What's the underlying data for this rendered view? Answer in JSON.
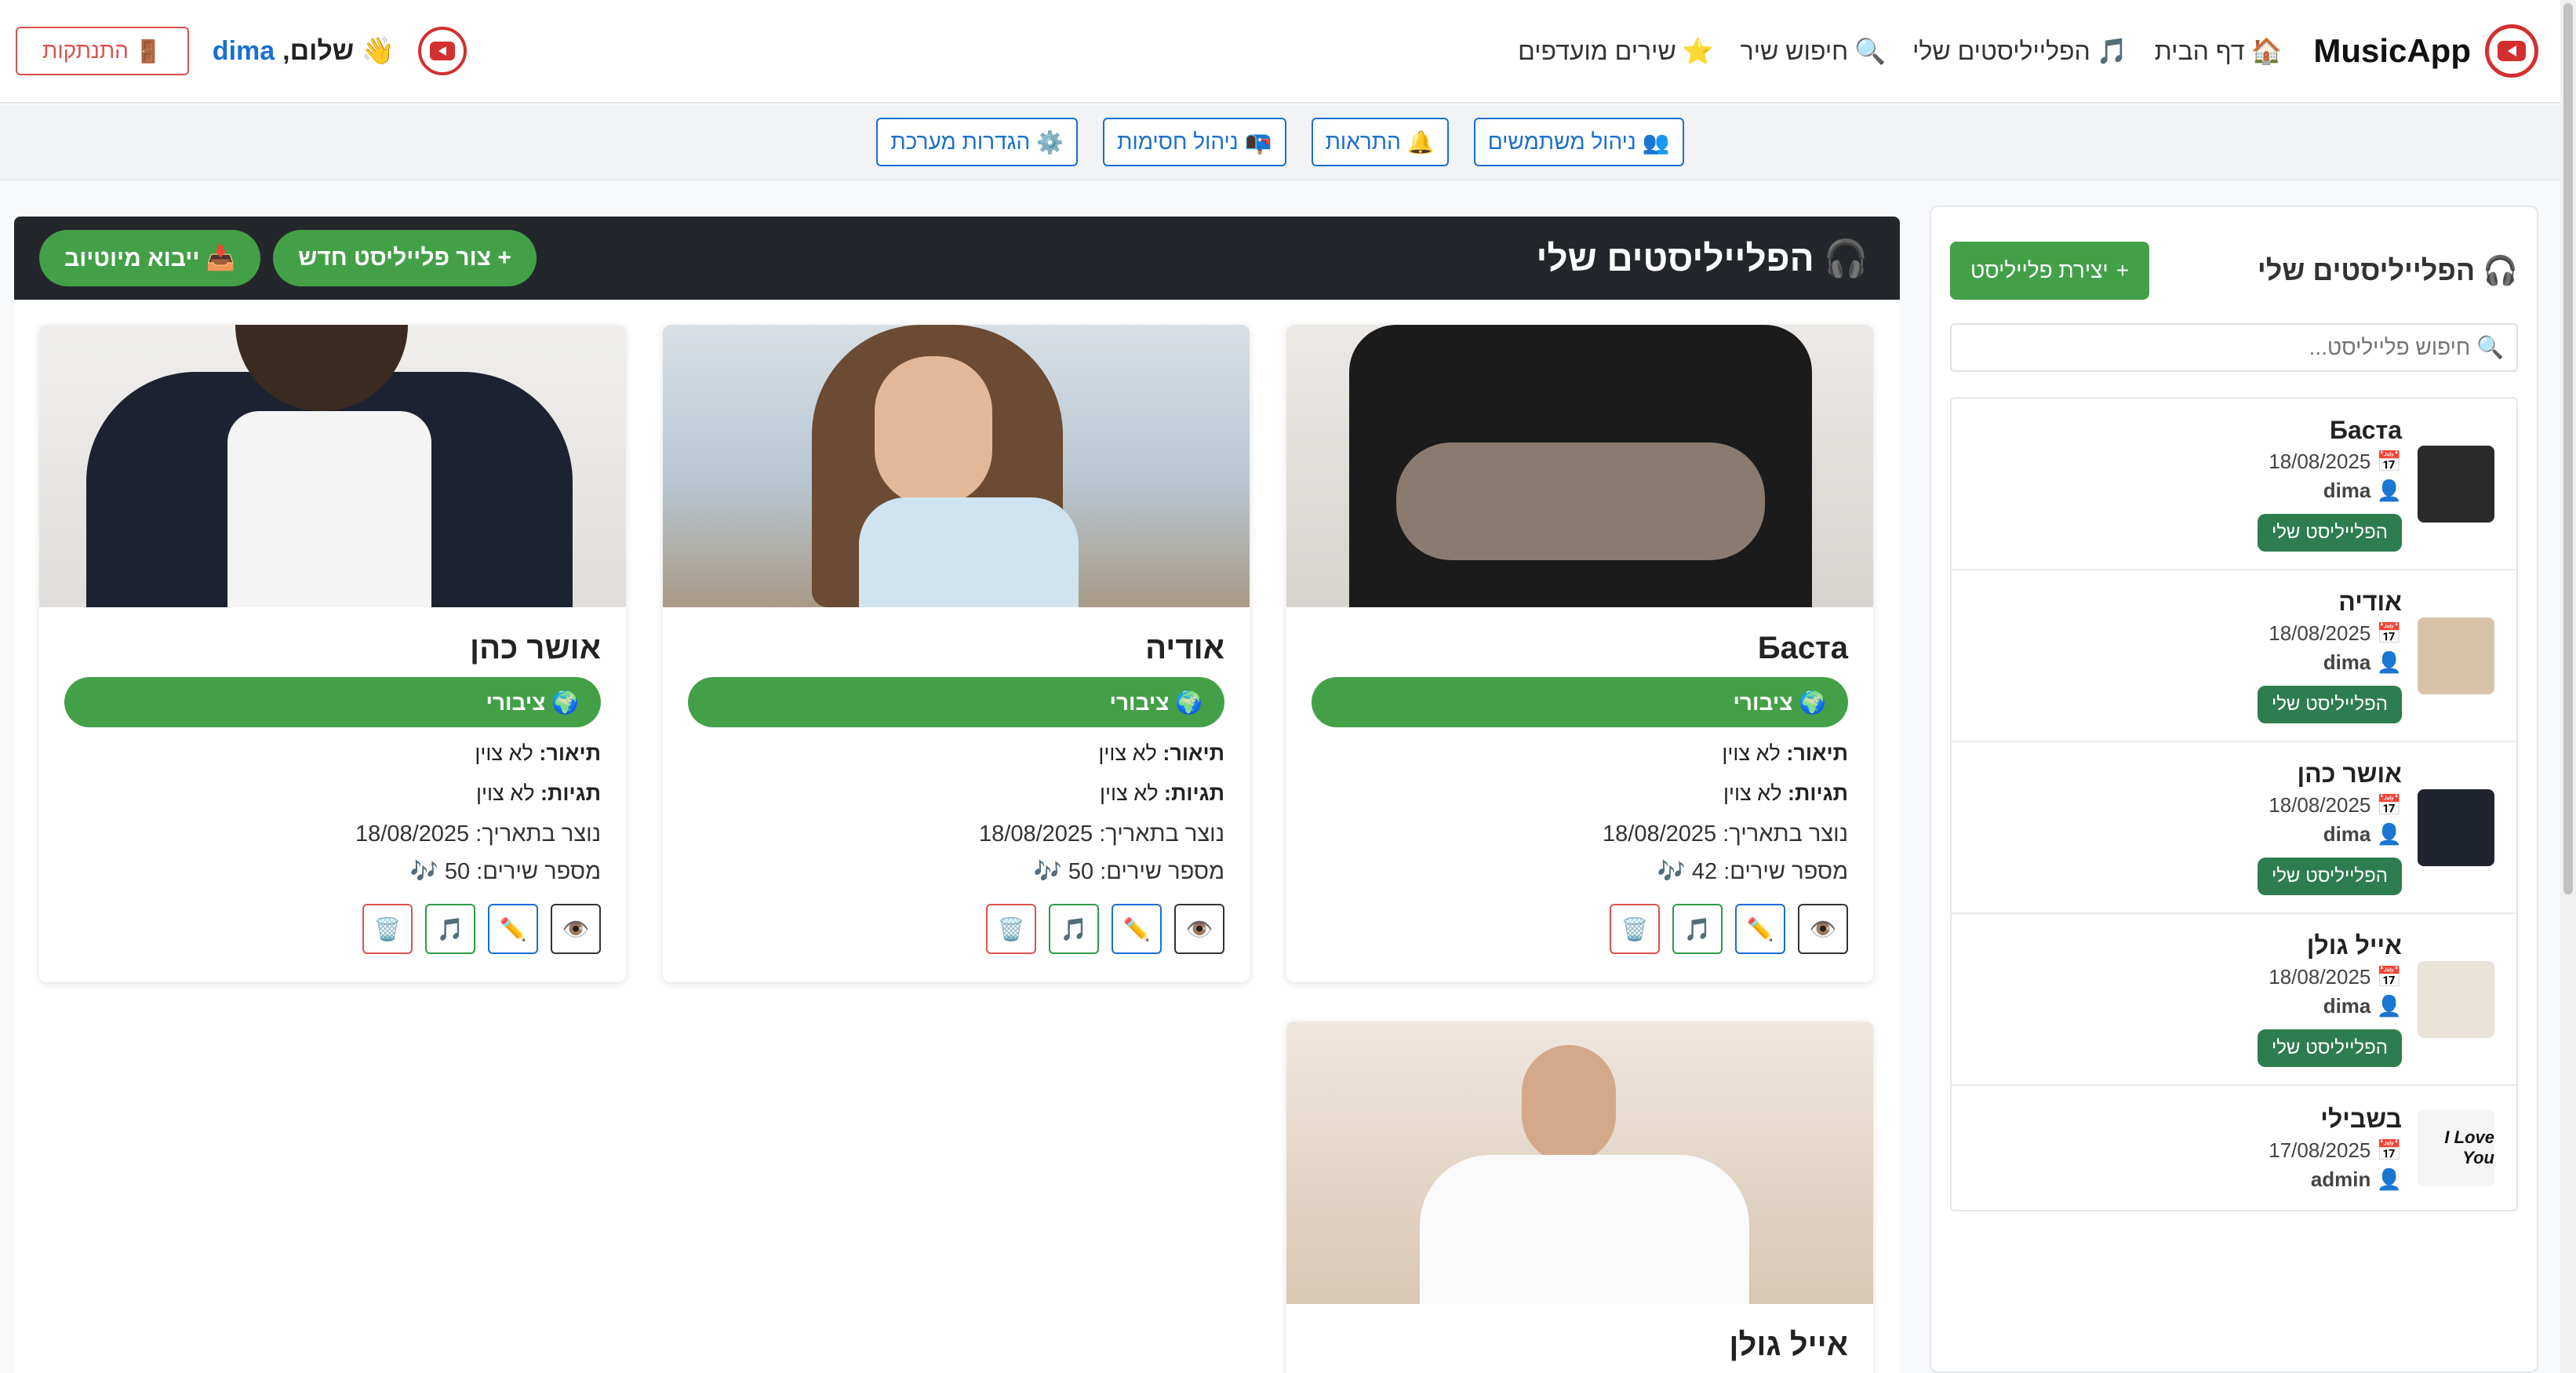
{
  "navbar": {
    "brand": "MusicApp",
    "links": [
      {
        "icon": "🏠",
        "label": "דף הבית"
      },
      {
        "icon": "🎵",
        "label": "הפלייליסטים שלי"
      },
      {
        "icon": "🔍",
        "label": "חיפוש שיר"
      },
      {
        "icon": "⭐",
        "label": "שירים מועדפים"
      }
    ],
    "greeting_prefix": "👋 שלום,",
    "username": "dima",
    "logout_icon": "🚪",
    "logout_label": "התנתקות"
  },
  "admin_bar": {
    "buttons": [
      {
        "icon": "👥",
        "label": "ניהול משתמשים"
      },
      {
        "icon": "🔔",
        "label": "התראות"
      },
      {
        "icon": "📭",
        "label": "ניהול חסימות"
      },
      {
        "icon": "⚙️",
        "label": "הגדרות מערכת"
      }
    ]
  },
  "sidebar": {
    "title_icon": "🎧",
    "title": "הפלייליסטים שלי",
    "create_icon": "+",
    "create_label": "יצירת פלייליסט",
    "search_placeholder": "🔍 חיפוש פלייליסט...",
    "items": [
      {
        "name": "Баста",
        "date": "📅 18/08/2025",
        "owner": "👤 dima",
        "badge": "הפלייליסט שלי"
      },
      {
        "name": "אודיה",
        "date": "📅 18/08/2025",
        "owner": "👤 dima",
        "badge": "הפלייליסט שלי"
      },
      {
        "name": "אושר כהן",
        "date": "📅 18/08/2025",
        "owner": "👤 dima",
        "badge": "הפלייליסט שלי"
      },
      {
        "name": "אייל גולן",
        "date": "📅 18/08/2025",
        "owner": "👤 dima",
        "badge": "הפלייליסט שלי"
      },
      {
        "name": "בשבילי",
        "date": "📅 17/08/2025",
        "owner": "👤 admin",
        "thumb_text": "I Love You"
      }
    ]
  },
  "main": {
    "title_icon": "🎧",
    "title": "הפלייליסטים שלי",
    "create_label": "+ צור פלייליסט חדש",
    "import_label": "📥 ייבוא מיוטיוב",
    "cards": [
      {
        "name": "Баста",
        "visibility": "🌍 ציבורי",
        "desc_label": "תיאור:",
        "desc_value": "לא צוין",
        "tags_label": "תגיות:",
        "tags_value": "לא צוין",
        "created": "נוצר בתאריך: 18/08/2025",
        "songs": "מספר שירים: 42 🎶"
      },
      {
        "name": "אודיה",
        "visibility": "🌍 ציבורי",
        "desc_label": "תיאור:",
        "desc_value": "לא צוין",
        "tags_label": "תגיות:",
        "tags_value": "לא צוין",
        "created": "נוצר בתאריך: 18/08/2025",
        "songs": "מספר שירים: 50 🎶"
      },
      {
        "name": "אושר כהן",
        "visibility": "🌍 ציבורי",
        "desc_label": "תיאור:",
        "desc_value": "לא צוין",
        "tags_label": "תגיות:",
        "tags_value": "לא צוין",
        "created": "נוצר בתאריך: 18/08/2025",
        "songs": "מספר שירים: 50 🎶"
      },
      {
        "name": "אייל גולן"
      }
    ],
    "card_actions": [
      "👁️",
      "✏️",
      "🎵",
      "🗑️"
    ]
  }
}
